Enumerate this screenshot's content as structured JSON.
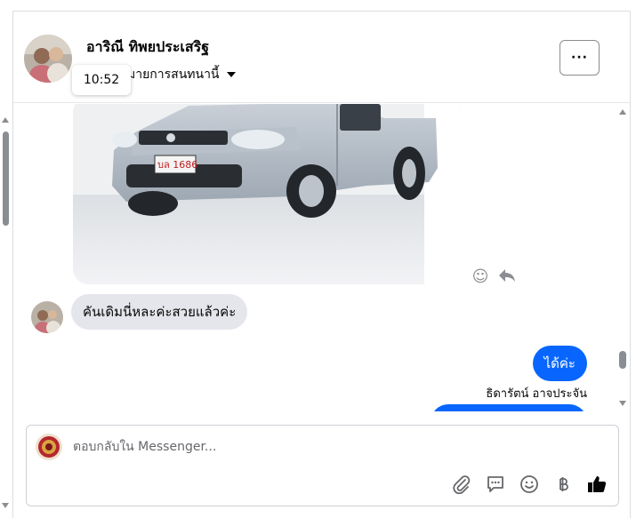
{
  "header": {
    "name": "อาริณี ทิพยประเสริฐ",
    "subtitle": "มายการสนทนานี้",
    "tooltip_time": "10:52",
    "more_label": "···"
  },
  "messages": {
    "incoming_text": "คันเดิมนี่หละค่ะสวยแล้วค่ะ",
    "outgoing_text": "ได้ค่ะ",
    "outgoing_sender": "ธิดารัตน์ อาจประจัน",
    "photo_plate": "บล 1686"
  },
  "composer": {
    "placeholder": "ตอบกลับใน Messenger...",
    "tools": [
      "attach-icon",
      "saved-reply-icon",
      "emoji-icon",
      "baht-icon",
      "like-icon"
    ]
  },
  "colors": {
    "accent": "#0866ff",
    "bubble_in": "#e4e6eb",
    "icon": "#65676b"
  }
}
